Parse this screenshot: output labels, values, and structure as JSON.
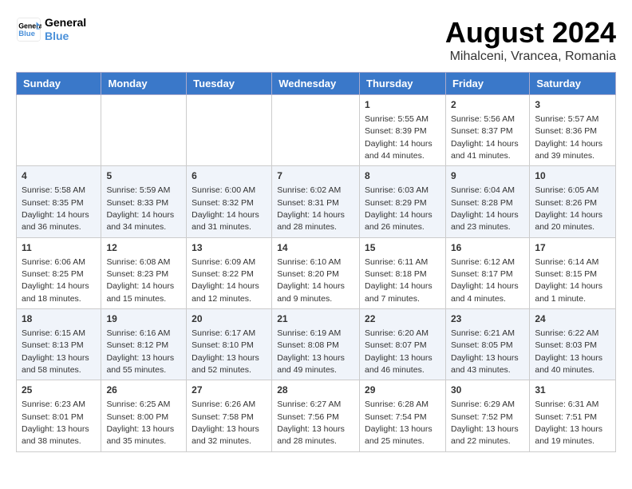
{
  "header": {
    "logo_line1": "General",
    "logo_line2": "Blue",
    "month_year": "August 2024",
    "location": "Mihalceni, Vrancea, Romania"
  },
  "days_of_week": [
    "Sunday",
    "Monday",
    "Tuesday",
    "Wednesday",
    "Thursday",
    "Friday",
    "Saturday"
  ],
  "weeks": [
    [
      {
        "day": "",
        "info": ""
      },
      {
        "day": "",
        "info": ""
      },
      {
        "day": "",
        "info": ""
      },
      {
        "day": "",
        "info": ""
      },
      {
        "day": "1",
        "info": "Sunrise: 5:55 AM\nSunset: 8:39 PM\nDaylight: 14 hours and 44 minutes."
      },
      {
        "day": "2",
        "info": "Sunrise: 5:56 AM\nSunset: 8:37 PM\nDaylight: 14 hours and 41 minutes."
      },
      {
        "day": "3",
        "info": "Sunrise: 5:57 AM\nSunset: 8:36 PM\nDaylight: 14 hours and 39 minutes."
      }
    ],
    [
      {
        "day": "4",
        "info": "Sunrise: 5:58 AM\nSunset: 8:35 PM\nDaylight: 14 hours and 36 minutes."
      },
      {
        "day": "5",
        "info": "Sunrise: 5:59 AM\nSunset: 8:33 PM\nDaylight: 14 hours and 34 minutes."
      },
      {
        "day": "6",
        "info": "Sunrise: 6:00 AM\nSunset: 8:32 PM\nDaylight: 14 hours and 31 minutes."
      },
      {
        "day": "7",
        "info": "Sunrise: 6:02 AM\nSunset: 8:31 PM\nDaylight: 14 hours and 28 minutes."
      },
      {
        "day": "8",
        "info": "Sunrise: 6:03 AM\nSunset: 8:29 PM\nDaylight: 14 hours and 26 minutes."
      },
      {
        "day": "9",
        "info": "Sunrise: 6:04 AM\nSunset: 8:28 PM\nDaylight: 14 hours and 23 minutes."
      },
      {
        "day": "10",
        "info": "Sunrise: 6:05 AM\nSunset: 8:26 PM\nDaylight: 14 hours and 20 minutes."
      }
    ],
    [
      {
        "day": "11",
        "info": "Sunrise: 6:06 AM\nSunset: 8:25 PM\nDaylight: 14 hours and 18 minutes."
      },
      {
        "day": "12",
        "info": "Sunrise: 6:08 AM\nSunset: 8:23 PM\nDaylight: 14 hours and 15 minutes."
      },
      {
        "day": "13",
        "info": "Sunrise: 6:09 AM\nSunset: 8:22 PM\nDaylight: 14 hours and 12 minutes."
      },
      {
        "day": "14",
        "info": "Sunrise: 6:10 AM\nSunset: 8:20 PM\nDaylight: 14 hours and 9 minutes."
      },
      {
        "day": "15",
        "info": "Sunrise: 6:11 AM\nSunset: 8:18 PM\nDaylight: 14 hours and 7 minutes."
      },
      {
        "day": "16",
        "info": "Sunrise: 6:12 AM\nSunset: 8:17 PM\nDaylight: 14 hours and 4 minutes."
      },
      {
        "day": "17",
        "info": "Sunrise: 6:14 AM\nSunset: 8:15 PM\nDaylight: 14 hours and 1 minute."
      }
    ],
    [
      {
        "day": "18",
        "info": "Sunrise: 6:15 AM\nSunset: 8:13 PM\nDaylight: 13 hours and 58 minutes."
      },
      {
        "day": "19",
        "info": "Sunrise: 6:16 AM\nSunset: 8:12 PM\nDaylight: 13 hours and 55 minutes."
      },
      {
        "day": "20",
        "info": "Sunrise: 6:17 AM\nSunset: 8:10 PM\nDaylight: 13 hours and 52 minutes."
      },
      {
        "day": "21",
        "info": "Sunrise: 6:19 AM\nSunset: 8:08 PM\nDaylight: 13 hours and 49 minutes."
      },
      {
        "day": "22",
        "info": "Sunrise: 6:20 AM\nSunset: 8:07 PM\nDaylight: 13 hours and 46 minutes."
      },
      {
        "day": "23",
        "info": "Sunrise: 6:21 AM\nSunset: 8:05 PM\nDaylight: 13 hours and 43 minutes."
      },
      {
        "day": "24",
        "info": "Sunrise: 6:22 AM\nSunset: 8:03 PM\nDaylight: 13 hours and 40 minutes."
      }
    ],
    [
      {
        "day": "25",
        "info": "Sunrise: 6:23 AM\nSunset: 8:01 PM\nDaylight: 13 hours and 38 minutes."
      },
      {
        "day": "26",
        "info": "Sunrise: 6:25 AM\nSunset: 8:00 PM\nDaylight: 13 hours and 35 minutes."
      },
      {
        "day": "27",
        "info": "Sunrise: 6:26 AM\nSunset: 7:58 PM\nDaylight: 13 hours and 32 minutes."
      },
      {
        "day": "28",
        "info": "Sunrise: 6:27 AM\nSunset: 7:56 PM\nDaylight: 13 hours and 28 minutes."
      },
      {
        "day": "29",
        "info": "Sunrise: 6:28 AM\nSunset: 7:54 PM\nDaylight: 13 hours and 25 minutes."
      },
      {
        "day": "30",
        "info": "Sunrise: 6:29 AM\nSunset: 7:52 PM\nDaylight: 13 hours and 22 minutes."
      },
      {
        "day": "31",
        "info": "Sunrise: 6:31 AM\nSunset: 7:51 PM\nDaylight: 13 hours and 19 minutes."
      }
    ]
  ]
}
